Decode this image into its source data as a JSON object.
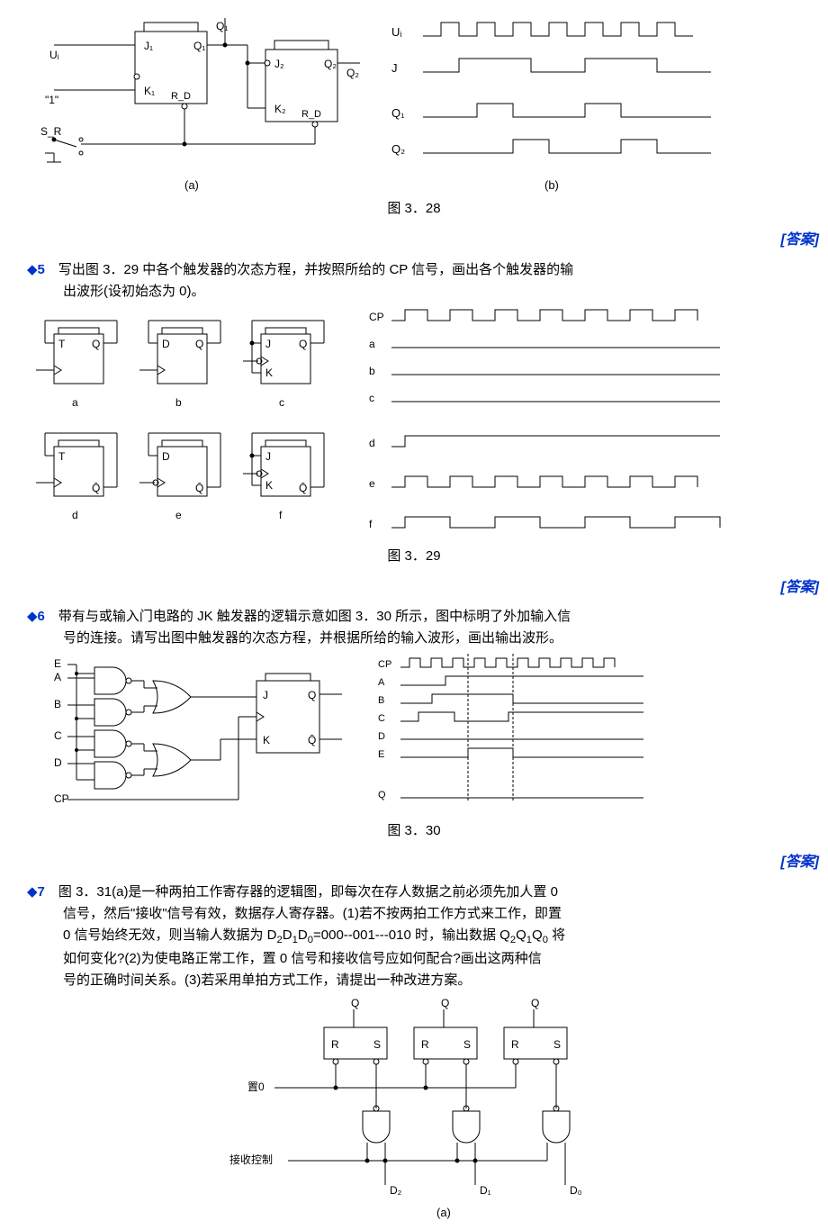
{
  "fig328": {
    "caption": "图 3．28",
    "left_label": "(a)",
    "right_label": "(b)",
    "signals": {
      "ui": "Uᵢ",
      "j": "J",
      "q1": "Q₁",
      "q2": "Q₂"
    },
    "components": {
      "ui_in": "Uᵢ",
      "one": "\"1\"",
      "sr": "S_R",
      "j1": "J₁",
      "k1": "K₁",
      "rd1": "R_D",
      "q1_out": "Q₁",
      "j2": "J₂",
      "k2": "K₂",
      "rd2": "R_D",
      "q2_out": "Q₂"
    }
  },
  "answer_label": "[答案]",
  "problem5": {
    "num": "5",
    "text_line1": "写出图 3．29 中各个触发器的次态方程，并按照所给的 CP 信号，画出各个触发器的输",
    "text_line2": "出波形(设初始态为 0)。"
  },
  "fig329": {
    "caption": "图 3．29",
    "labels": {
      "a": "a",
      "b": "b",
      "c": "c",
      "d": "d",
      "e": "e",
      "f": "f"
    },
    "pins": {
      "t": "T",
      "d": "D",
      "j": "J",
      "k": "K",
      "q": "Q",
      "qbar": "Q̄"
    },
    "waveforms": {
      "cp": "CP",
      "a": "a",
      "b": "b",
      "c": "c",
      "d": "d",
      "e": "e",
      "f": "f"
    }
  },
  "problem6": {
    "num": "6",
    "text_line1": "带有与或输入门电路的 JK 触发器的逻辑示意如图 3．30 所示，图中标明了外加输入信",
    "text_line2": "号的连接。请写出图中触发器的次态方程，并根据所给的输入波形，画出输出波形。"
  },
  "fig330": {
    "caption": "图 3．30",
    "inputs": {
      "e": "E",
      "a": "A",
      "b": "B",
      "c": "C",
      "d": "D",
      "cp": "CP"
    },
    "pins": {
      "j": "J",
      "k": "K",
      "q": "Q",
      "qbar": "Q̄"
    },
    "waveforms": {
      "cp": "CP",
      "a": "A",
      "b": "B",
      "c": "C",
      "d": "D",
      "e": "E",
      "q": "Q"
    }
  },
  "problem7": {
    "num": "7",
    "text_line1": "图 3．31(a)是一种两拍工作寄存器的逻辑图，即每次在存人数据之前必须先加人置 0",
    "text_line2": "信号，然后\"接收\"信号有效，数据存人寄存器。(1)若不按两拍工作方式来工作，即置",
    "text_line3_prefix": "0 信号始终无效，则当输人数据为 D",
    "text_line3_mid": "=000--001---010 时，输出数据 Q",
    "text_line3_suffix": " 将",
    "text_line4": "如何变化?(2)为使电路正常工作，置 0 信号和接收信号应如何配合?画出这两种信",
    "text_line5": "号的正确时间关系。(3)若采用单拍方式工作，请提出一种改进方案。",
    "sub_d2": "2",
    "sub_d1": "1",
    "sub_d0": "0",
    "sub_q2": "2",
    "sub_q1": "1",
    "sub_q0": "0"
  },
  "fig331": {
    "label_a": "(a)",
    "q": "Q",
    "r": "R",
    "s": "S",
    "reset": "置0",
    "recv": "接收控制",
    "d2": "D₂",
    "d1": "D₁",
    "d0": "D₀"
  }
}
